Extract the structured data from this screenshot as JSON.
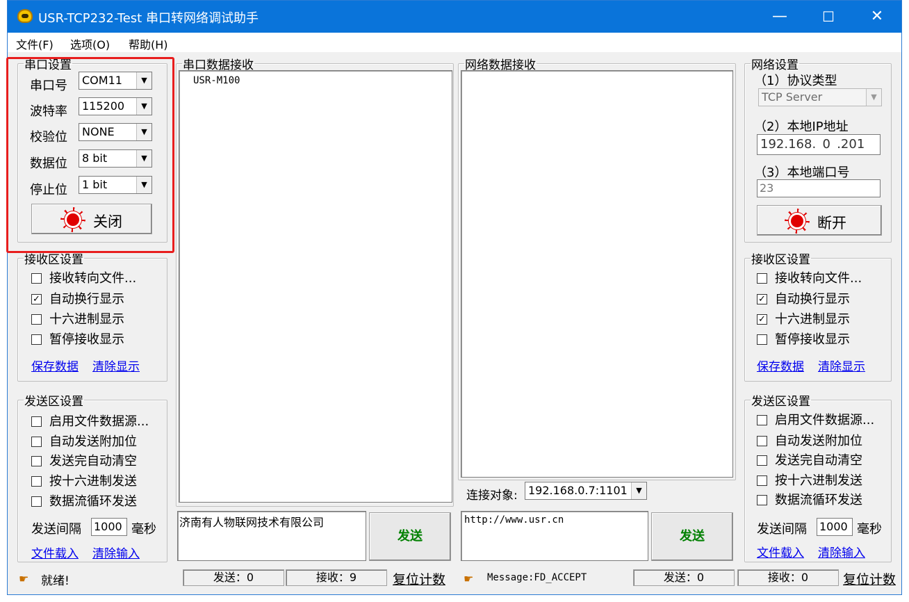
{
  "window": {
    "title": "USR-TCP232-Test 串口转网络调试助手",
    "minimize": "—",
    "maximize": "☐",
    "close": "✕"
  },
  "menu": {
    "file": "文件(F)",
    "options": "选项(O)",
    "help": "帮助(H)"
  },
  "serial_settings": {
    "legend": "串口设置",
    "port_label": "串口号",
    "port_value": "COM11",
    "baud_label": "波特率",
    "baud_value": "115200",
    "parity_label": "校验位",
    "parity_value": "NONE",
    "databits_label": "数据位",
    "databits_value": "8 bit",
    "stopbits_label": "停止位",
    "stopbits_value": "1 bit",
    "toggle_button": "关闭"
  },
  "left_receive_settings": {
    "legend": "接收区设置",
    "opt1": "接收转向文件...",
    "opt1_checked": false,
    "opt2": "自动换行显示",
    "opt2_checked": true,
    "opt3": "十六进制显示",
    "opt3_checked": false,
    "opt4": "暂停接收显示",
    "opt4_checked": false,
    "save": "保存数据",
    "clear": "清除显示"
  },
  "left_send_settings": {
    "legend": "发送区设置",
    "opt1": "启用文件数据源...",
    "opt2": "自动发送附加位",
    "opt3": "发送完自动清空",
    "opt4": "按十六进制发送",
    "opt5": "数据流循环发送",
    "interval_label": "发送间隔",
    "interval_value": "1000",
    "interval_unit": "毫秒",
    "load": "文件载入",
    "clear": "清除输入"
  },
  "serial_receive": {
    "legend": "串口数据接收",
    "content": "USR-M100"
  },
  "serial_send": {
    "content": "济南有人物联网技术有限公司",
    "button": "发送"
  },
  "net_receive": {
    "legend": "网络数据接收",
    "content": ""
  },
  "net_target": {
    "label": "连接对象:",
    "value": "192.168.0.7:1101"
  },
  "net_send": {
    "content": "http://www.usr.cn",
    "button": "发送"
  },
  "net_settings": {
    "legend": "网络设置",
    "protocol_label": "（1）协议类型",
    "protocol_value": "TCP Server",
    "ip_label": "（2）本地IP地址",
    "ip": [
      "192",
      "168",
      "0",
      "201"
    ],
    "port_label": "（3）本地端口号",
    "port_value": "23",
    "toggle_button": "断开"
  },
  "right_receive_settings": {
    "legend": "接收区设置",
    "opt1": "接收转向文件...",
    "opt1_checked": false,
    "opt2": "自动换行显示",
    "opt2_checked": true,
    "opt3": "十六进制显示",
    "opt3_checked": true,
    "opt4": "暂停接收显示",
    "opt4_checked": false,
    "save": "保存数据",
    "clear": "清除显示"
  },
  "right_send_settings": {
    "legend": "发送区设置",
    "opt1": "启用文件数据源...",
    "opt2": "自动发送附加位",
    "opt3": "发送完自动清空",
    "opt4": "按十六进制发送",
    "opt5": "数据流循环发送",
    "interval_label": "发送间隔",
    "interval_value": "1000",
    "interval_unit": "毫秒",
    "load": "文件载入",
    "clear": "清除输入"
  },
  "status_left": {
    "text": "就绪!",
    "sent": "发送：0",
    "received": "接收：9",
    "reset": "复位计数"
  },
  "status_right": {
    "text": "Message:FD_ACCEPT",
    "sent": "发送：0",
    "received": "接收：0",
    "reset": "复位计数"
  },
  "colors": {
    "titlebar": "#0a74da",
    "highlight": "#e81e1e",
    "send_text": "#008000",
    "link": "#0000ee"
  }
}
